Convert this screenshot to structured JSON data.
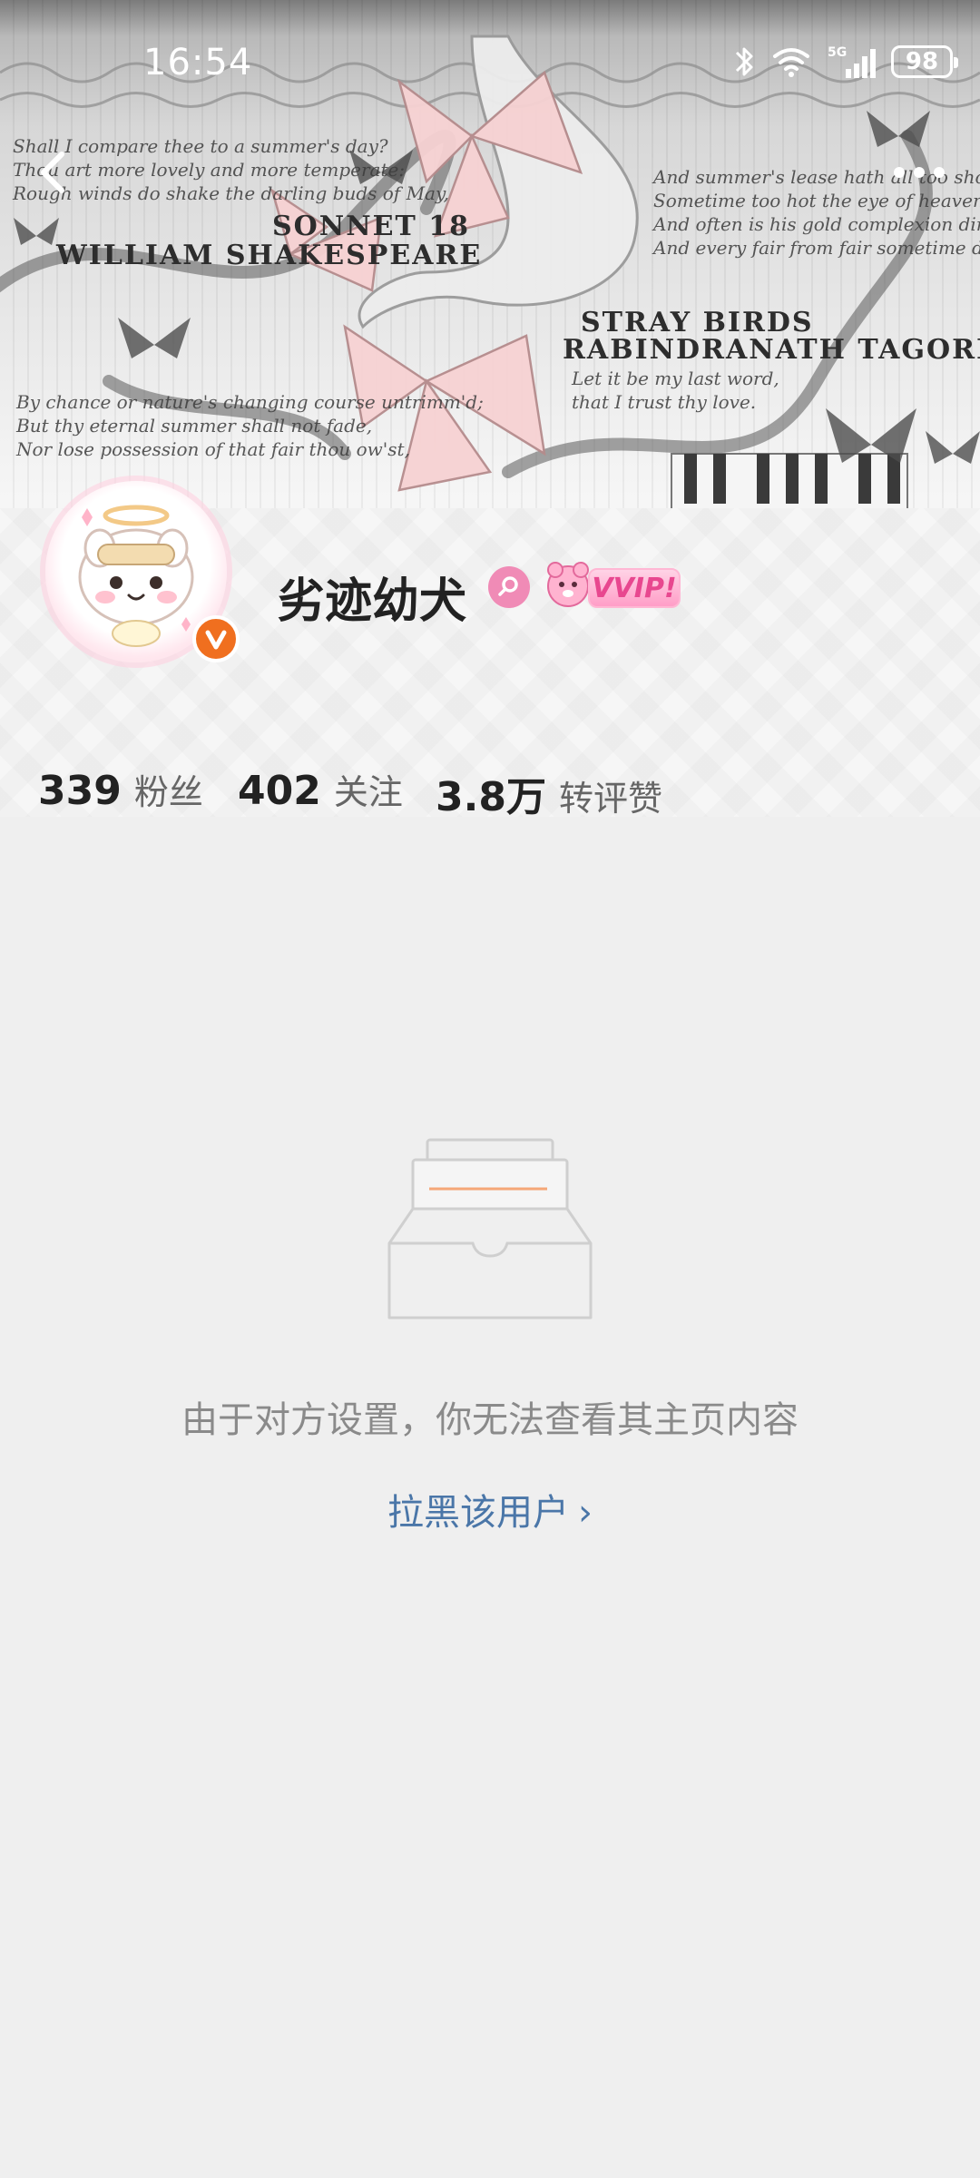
{
  "status_bar": {
    "time": "16:54",
    "network": "5G",
    "battery": "98"
  },
  "banner": {
    "poem_left": "Shall I compare thee to a summer's day?\nThou art more lovely and more temperate:\nRough winds do shake the darling buds of May,",
    "poem_left_lower": "By chance or nature's changing course untrimm'd;\nBut thy eternal summer shall not fade,\nNor lose possession of that fair thou ow'st,",
    "title_left_1": "SONNET 18",
    "title_left_2": "WILLIAM SHAKESPEARE",
    "poem_right": "And summer's lease hath all too short a date;\nSometime too hot the eye of heaven shines,\nAnd often is his gold complexion dimm'd;\nAnd every fair from fair sometime declines,",
    "title_right_1": "STRAY BIRDS",
    "title_right_2": "RABINDRANATH TAGORE",
    "poem_mid": "Let it be my last word,\nthat I trust thy love."
  },
  "profile": {
    "username": "劣迹幼犬",
    "vip_label": "VVIP!",
    "stats": [
      {
        "value": "339",
        "label": "粉丝"
      },
      {
        "value": "402",
        "label": "关注"
      },
      {
        "value": "3.8万",
        "label": "转评赞"
      }
    ]
  },
  "empty_state": {
    "message": "由于对方设置，你无法查看其主页内容",
    "action_label": "拉黑该用户"
  },
  "colors": {
    "background": "#efefef",
    "link": "#4a76a8",
    "verified": "#f06f1f",
    "gender": "#f08bb6",
    "illustration_line": "#f5a777"
  }
}
